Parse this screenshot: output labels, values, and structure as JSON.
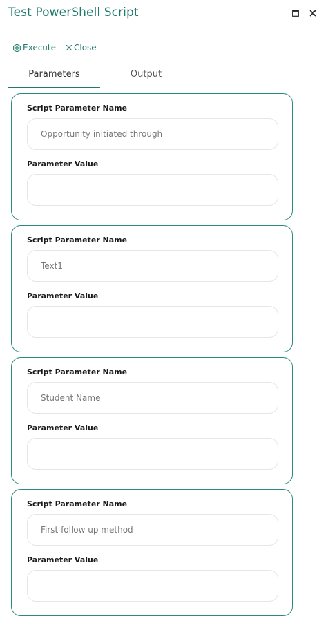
{
  "window": {
    "title": "Test PowerShell Script",
    "maximize_icon": "maximize-icon",
    "close_icon": "close-icon"
  },
  "toolbar": {
    "execute_label": "Execute",
    "execute_icon": "gear-icon",
    "close_label": "Close",
    "close_icon": "x-icon"
  },
  "tabs": [
    {
      "label": "Parameters",
      "active": true
    },
    {
      "label": "Output",
      "active": false
    }
  ],
  "parameters": [
    {
      "name_label": "Script Parameter Name",
      "name_value": "Opportunity initiated through",
      "value_label": "Parameter Value",
      "value": ""
    },
    {
      "name_label": "Script Parameter Name",
      "name_value": "Text1",
      "value_label": "Parameter Value",
      "value": ""
    },
    {
      "name_label": "Script Parameter Name",
      "name_value": "Student Name",
      "value_label": "Parameter Value",
      "value": ""
    },
    {
      "name_label": "Script Parameter Name",
      "name_value": "First follow up method",
      "value_label": "Parameter Value",
      "value": ""
    }
  ],
  "colors": {
    "accent": "#1f7a6d",
    "card_border": "#2a8a7b",
    "field_border": "#e6e6e6"
  }
}
